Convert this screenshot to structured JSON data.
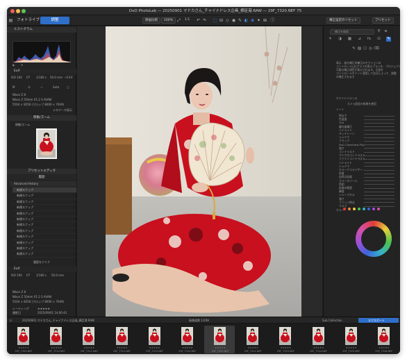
{
  "window": {
    "title": "DxO PhotoLab — 20250901 マドカさん_チャイナドレス企画_横臣港.RAW — 29F_7320.NEF 75"
  },
  "toolbar": {
    "tab_library": "フォトライブラリ",
    "tab_customize": "調整",
    "compare_label": "原画比較",
    "zoom_label": "100%",
    "zoom_value": "1:1",
    "reset_label": "構正設定のリセット",
    "preset_label": "プリセット"
  },
  "left_panel": {
    "histogram_title": "ヒストグラム",
    "histogram_channels": [
      "RGB",
      "R",
      "G",
      "B",
      "L"
    ],
    "exif_title": "Exif",
    "exif_values": [
      "ISO 100",
      "f/7",
      "1/160 s",
      "50.0 mm",
      "−0 EV"
    ],
    "camera": "Nikon Z 8",
    "lens": "Nikon Z 50mm f/1.2 S AVAW",
    "dims": "5504 × 8256 (クロップ 8000 × 7649)",
    "metadata_label": "メタデータ表示",
    "navigator_title": "移動/ズーム",
    "navigator_sub": "移動/ズーム",
    "history_title": "プリセットエディタ",
    "history_subtitle": "履歴",
    "history_group": "Advanced History",
    "history_items": [
      "新規スナップ",
      "新規スナップ",
      "新規スナップ",
      "新規スナップ",
      "新規スナップ",
      "新規スナップ",
      "新規スナップ",
      "新規スナップ",
      "新規スナップ",
      "新規スナップ",
      "新規スナップ",
      "新規スナップ"
    ],
    "history_clear": "履歴をクリア",
    "exif2_title": "Exif",
    "exif2_values": [
      "ISO 100",
      "f/7",
      "1/160 s",
      "50.0 mm"
    ],
    "camera2": "Nikon Z 8",
    "lens2": "Nikon Z 50mm f/1.2 S AVAW",
    "dims2": "5504 × 8256 (クロップ 8000 × 7649)",
    "rating_label": "レーティング",
    "rating_stars": "★★★★★",
    "date_label": "撮影日",
    "date_value": "2025/09/01 14:00:41"
  },
  "right_panel": {
    "search_placeholder": "補正を検索",
    "info_lines": [
      "表示、部分補正的補正のセクションの",
      "コントロール(点)グラフの表示ブラシを、プロジェクト",
      "可能な補正項目が表示されます。正面を",
      "コントロールポイント適用して自分によって、調整",
      "の補正されます"
    ],
    "section_wb": "ホワイトバランス",
    "wb_mode": "カメラ設定の結果を使用",
    "section_tone": "トーン",
    "sliders": [
      "明るさ",
      "色温度",
      "Tint",
      "露光量補正",
      "ハイライト",
      "ミッドトーン",
      "シャドウ",
      "ブラック",
      "DxO ClearView Plus",
      "強さ",
      "コントラスト",
      "マイクロコントラスト",
      "ファインコントラスト",
      "ハイライト",
      "シャドウ",
      "カラーアコライザー",
      "彩度",
      "自然な彩度",
      "カラーホイール",
      "色相",
      "彩度の範囲",
      "輝度",
      "シャープネス",
      "強さ",
      "フリンジ除去",
      "マスク"
    ],
    "section_color": "カラー",
    "swatches": [
      "#e03b3b",
      "#e6842f",
      "#e8d03a",
      "#4cc24c",
      "#35b0c9",
      "#3f62d9",
      "#a14fd6",
      "#d54fa8"
    ]
  },
  "filmstrip": {
    "folder": "20250901 マドカさん_チャイナドレス企画_横臣港.RAW",
    "count_label": "画像枚数 1/208",
    "collection_label": "Sub Collection",
    "export_label": "エクスポート",
    "items": [
      {
        "name": "29F_7309.NEF",
        "stars": "★★★★★"
      },
      {
        "name": "29F_7310.NEF",
        "stars": "★★★★★"
      },
      {
        "name": "29F_7311.NEF",
        "stars": "★★★★★"
      },
      {
        "name": "29F_7312.NEF",
        "stars": "★★★★★"
      },
      {
        "name": "29F_7313.NEF",
        "stars": "★★★★★"
      },
      {
        "name": "29F_7314.NEF",
        "stars": "★★★★★"
      },
      {
        "name": "29F_7320.NEF",
        "stars": "★★★★★"
      },
      {
        "name": "29F_7321.NEF",
        "stars": "★★★★★"
      },
      {
        "name": "29F_7323.NEF",
        "stars": "★★★★★"
      },
      {
        "name": "29F_7324.NEF",
        "stars": "★★★★★"
      },
      {
        "name": "29F_7325.NEF",
        "stars": "★★★★★"
      },
      {
        "name": "29F_7326.NEF",
        "stars": "★★★★★"
      }
    ]
  },
  "colors": {
    "accent": "#2f6fc9",
    "dress": "#c8101e",
    "panel": "#232323"
  }
}
